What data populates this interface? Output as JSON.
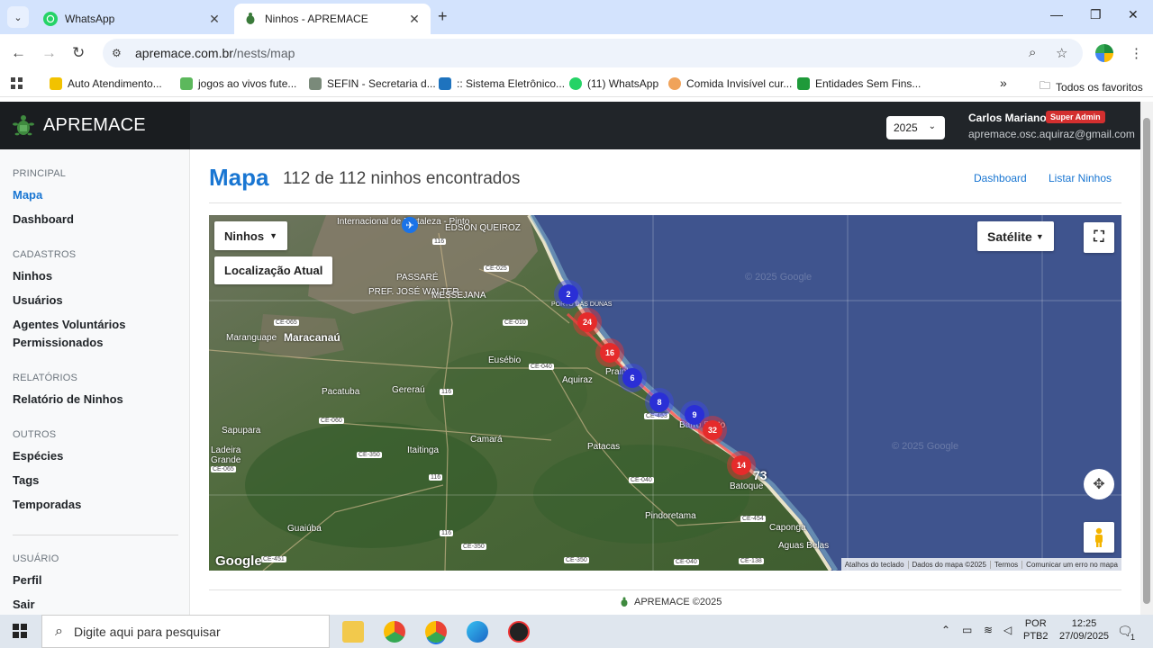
{
  "browser": {
    "tabs": [
      {
        "title": "WhatsApp",
        "active": false
      },
      {
        "title": "Ninhos - APREMACE",
        "active": true
      }
    ],
    "url_host": "apremace.com.br",
    "url_path": "/nests/map",
    "bookmarks": [
      "Auto Atendimento...",
      "jogos ao vivos  fute...",
      "SEFIN - Secretaria d...",
      ":: Sistema Eletrônico...",
      "(11) WhatsApp",
      "Comida Invisível cur...",
      "Entidades Sem Fins...",
      "Todos os favoritos"
    ]
  },
  "app": {
    "brand": "APREMACE",
    "year": "2025",
    "user_name": "Carlos Mariano",
    "user_role": "Super Admin",
    "user_email": "apremace.osc.aquiraz@gmail.com"
  },
  "sidebar": {
    "sections": [
      {
        "title": "PRINCIPAL",
        "items": [
          "Mapa",
          "Dashboard"
        ]
      },
      {
        "title": "CADASTROS",
        "items": [
          "Ninhos",
          "Usuários",
          "Agentes Voluntários",
          "Permissionados"
        ]
      },
      {
        "title": "RELATÓRIOS",
        "items": [
          "Relatório de Ninhos"
        ]
      },
      {
        "title": "OUTROS",
        "items": [
          "Espécies",
          "Tags",
          "Temporadas"
        ]
      },
      {
        "title": "USUÁRIO",
        "items": [
          "Perfil",
          "Sair"
        ]
      }
    ]
  },
  "main": {
    "title": "Mapa",
    "subtitle": "112 de 112 ninhos encontrados",
    "links": [
      "Dashboard",
      "Listar Ninhos"
    ]
  },
  "map": {
    "layer_button": "Ninhos",
    "location_button": "Localização Atual",
    "maptype_button": "Satélite",
    "clusters": [
      {
        "count": "2",
        "color": "blue"
      },
      {
        "count": "24",
        "color": "red"
      },
      {
        "count": "16",
        "color": "red"
      },
      {
        "count": "6",
        "color": "blue"
      },
      {
        "count": "8",
        "color": "blue"
      },
      {
        "count": "9",
        "color": "blue"
      },
      {
        "count": "32",
        "color": "red"
      },
      {
        "count": "14",
        "color": "red"
      },
      {
        "count": "73",
        "color": "white"
      }
    ],
    "places": [
      "Internacional de Fortaleza - Pinto",
      "EDSON QUEIROZ",
      "PASSARÉ",
      "PREF. JOSÉ WALTER",
      "MESSEJANA",
      "Maracanaú",
      "Maranguape",
      "Eusébio",
      "Aquiraz",
      "Pacatuba",
      "Gereraú",
      "Sapupara",
      "Ladeira Grande",
      "Itaitinga",
      "Camará",
      "Patacas",
      "Guaiúba",
      "Pindoretama",
      "Caponga",
      "Aguas Belas",
      "Prainha",
      "Barro Preto",
      "Batoque",
      "PORTO DAS DUNAS"
    ],
    "roads": [
      "116",
      "CE-025",
      "CE-065",
      "CE-010",
      "CE-040",
      "CE-060",
      "CE-350",
      "CE-451",
      "CE-454",
      "CE-138",
      "CE-453"
    ],
    "watermark": "© 2025 Google",
    "google_logo": "Google",
    "footer_links": [
      "Atalhos do teclado",
      "Dados do mapa ©2025",
      "Termos",
      "Comunicar um erro no mapa"
    ]
  },
  "footer": {
    "text": "APREMACE ©2025"
  },
  "taskbar": {
    "search_placeholder": "Digite aqui para pesquisar",
    "lang": "POR",
    "layout": "PTB2",
    "time": "12:25",
    "date": "27/09/2025",
    "notif_count": "1"
  },
  "colors": {
    "accent": "#1976d2",
    "header": "#212529",
    "badge": "#d32f2f"
  }
}
